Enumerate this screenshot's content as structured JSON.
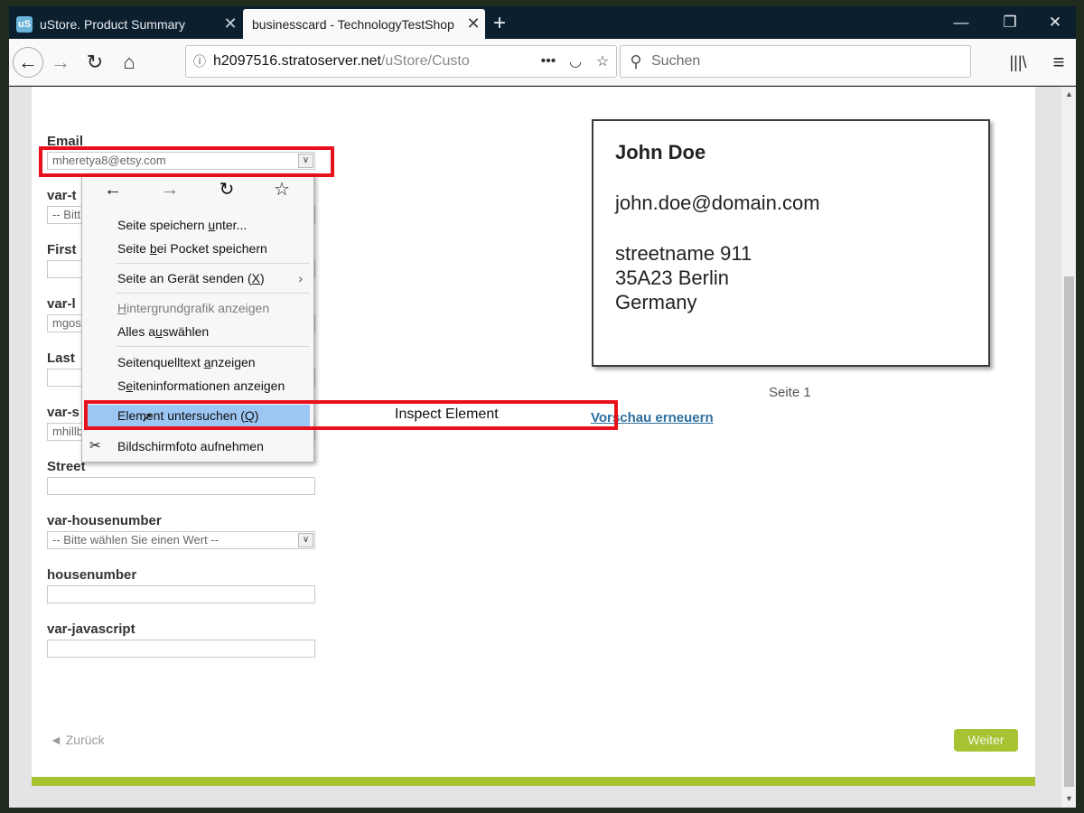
{
  "browser": {
    "tabs": [
      {
        "favicon": "uS",
        "title": "uStore. Product Summary",
        "active": false
      },
      {
        "favicon": "",
        "title": "businesscard - TechnologyTestShop",
        "active": true
      }
    ],
    "new_tab_label": "+",
    "window_controls": {
      "minimize": "—",
      "maximize": "❐",
      "close": "✕"
    },
    "url": {
      "host": "h2097516.stratoserver.net",
      "path": "/uStore/Custo"
    },
    "search_placeholder": "Suchen"
  },
  "form": {
    "email": {
      "label": "Email",
      "value": "mheretya8@etsy.com"
    },
    "var_title": {
      "label_visible": "var-t",
      "value_visible": "-- Bitt"
    },
    "first": {
      "label_visible": "First"
    },
    "var_last": {
      "label_visible": "var-l",
      "value_visible": "mgos"
    },
    "last": {
      "label_visible": "Last"
    },
    "var_street": {
      "label_visible": "var-s",
      "value_visible": "mhillb"
    },
    "street": {
      "label": "Street"
    },
    "var_housenumber": {
      "label": "var-housenumber",
      "value": "-- Bitte wählen Sie einen Wert --"
    },
    "housenumber": {
      "label": "housenumber"
    },
    "var_javascript": {
      "label": "var-javascript"
    }
  },
  "card": {
    "name": "John Doe",
    "email": "john.doe@domain.com",
    "street": "streetname 911",
    "city": "35A23 Berlin",
    "country": "Germany"
  },
  "preview": {
    "page_indicator": "Seite 1",
    "refresh_link": "Vorschau erneuern"
  },
  "footer": {
    "back_label": "◄  Zurück",
    "next_label": "Weiter"
  },
  "context_menu": {
    "items": [
      {
        "pre": "Seite speichern ",
        "key": "u",
        "post": "nter..."
      },
      {
        "pre": "Seite ",
        "key": "b",
        "post": "ei Pocket speichern"
      },
      {
        "pre": "Seite an Gerät senden (",
        "key": "X",
        "post": ")"
      },
      {
        "pre": "",
        "key": "H",
        "post": "intergrundgrafik anzeigen"
      },
      {
        "pre": "Alles a",
        "key": "u",
        "post": "swählen"
      },
      {
        "pre": "Seitenquelltext ",
        "key": "a",
        "post": "nzeigen"
      },
      {
        "pre": "S",
        "key": "e",
        "post": "iteninformationen anzeigen"
      },
      {
        "pre": "Element untersuchen (",
        "key": "Q",
        "post": ")"
      },
      {
        "pre": "Bildschirmfoto aufnehmen",
        "key": "",
        "post": ""
      }
    ],
    "submenu_arrow": "›"
  },
  "annotation": {
    "label": "Inspect Element"
  },
  "colors": {
    "accent_green": "#a7c332",
    "annotation_red": "#e8111b",
    "menu_highlight": "#9cc6f3",
    "link_blue": "#2e6f9e",
    "tabbar_dark": "#0c1f2e"
  }
}
